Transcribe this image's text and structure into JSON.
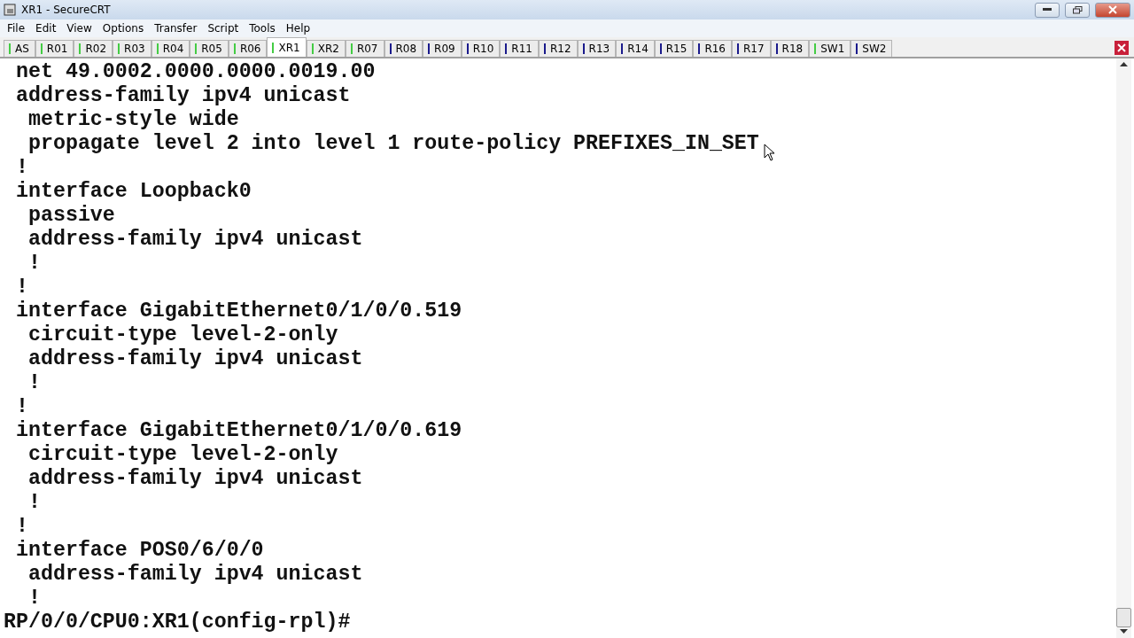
{
  "window": {
    "title": "XR1 - SecureCRT"
  },
  "menu": [
    "File",
    "Edit",
    "View",
    "Options",
    "Transfer",
    "Script",
    "Tools",
    "Help"
  ],
  "tabs": [
    {
      "label": "AS",
      "selected": false,
      "color": "#44cc44"
    },
    {
      "label": "R01",
      "selected": false,
      "color": "#44cc44"
    },
    {
      "label": "R02",
      "selected": false,
      "color": "#44cc44"
    },
    {
      "label": "R03",
      "selected": false,
      "color": "#44cc44"
    },
    {
      "label": "R04",
      "selected": false,
      "color": "#44cc44"
    },
    {
      "label": "R05",
      "selected": false,
      "color": "#44cc44"
    },
    {
      "label": "R06",
      "selected": false,
      "color": "#44cc44"
    },
    {
      "label": "XR1",
      "selected": true,
      "color": "#44cc44"
    },
    {
      "label": "XR2",
      "selected": false,
      "color": "#44cc44"
    },
    {
      "label": "R07",
      "selected": false,
      "color": "#44cc44"
    },
    {
      "label": "R08",
      "selected": false,
      "color": "#1a1a8c"
    },
    {
      "label": "R09",
      "selected": false,
      "color": "#1a1a8c"
    },
    {
      "label": "R10",
      "selected": false,
      "color": "#1a1a8c"
    },
    {
      "label": "R11",
      "selected": false,
      "color": "#1a1a8c"
    },
    {
      "label": "R12",
      "selected": false,
      "color": "#1a1a8c"
    },
    {
      "label": "R13",
      "selected": false,
      "color": "#1a1a8c"
    },
    {
      "label": "R14",
      "selected": false,
      "color": "#1a1a8c"
    },
    {
      "label": "R15",
      "selected": false,
      "color": "#1a1a8c"
    },
    {
      "label": "R16",
      "selected": false,
      "color": "#1a1a8c"
    },
    {
      "label": "R17",
      "selected": false,
      "color": "#1a1a8c"
    },
    {
      "label": "R18",
      "selected": false,
      "color": "#1a1a8c"
    },
    {
      "label": "SW1",
      "selected": false,
      "color": "#44cc44"
    },
    {
      "label": "SW2",
      "selected": false,
      "color": "#1a1a8c"
    }
  ],
  "terminal": {
    "lines": [
      " net 49.0002.0000.0000.0019.00",
      " address-family ipv4 unicast",
      "  metric-style wide",
      "  propagate level 2 into level 1 route-policy PREFIXES_IN_SET",
      " !",
      " interface Loopback0",
      "  passive",
      "  address-family ipv4 unicast",
      "  !",
      " !",
      " interface GigabitEthernet0/1/0/0.519",
      "  circuit-type level-2-only",
      "  address-family ipv4 unicast",
      "  !",
      " !",
      " interface GigabitEthernet0/1/0/0.619",
      "  circuit-type level-2-only",
      "  address-family ipv4 unicast",
      "  !",
      " !",
      " interface POS0/6/0/0",
      "  address-family ipv4 unicast",
      "  !",
      "RP/0/0/CPU0:XR1(config-rpl)#"
    ]
  }
}
